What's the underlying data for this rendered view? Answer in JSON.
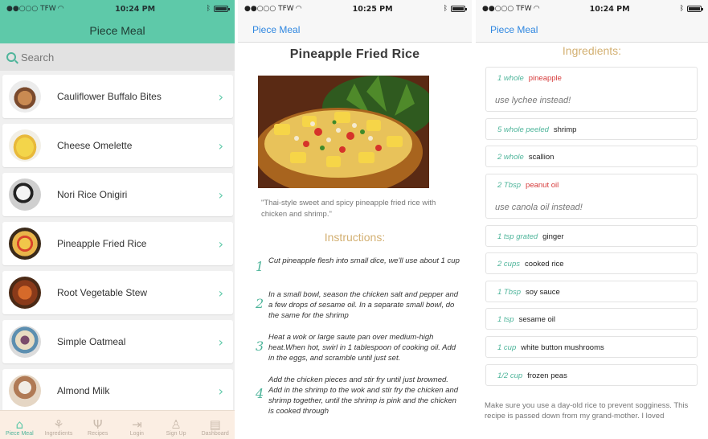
{
  "list_screen": {
    "status": {
      "carrier": "●●○○○ TFW",
      "time": "10:24 PM"
    },
    "title": "Piece Meal",
    "search_placeholder": "Search",
    "recipes": [
      {
        "name": "Cauliflower Buffalo Bites"
      },
      {
        "name": "Cheese Omelette"
      },
      {
        "name": "Nori Rice Onigiri"
      },
      {
        "name": "Pineapple Fried Rice"
      },
      {
        "name": "Root Vegetable Stew"
      },
      {
        "name": "Simple Oatmeal"
      },
      {
        "name": "Almond Milk"
      }
    ],
    "tabs": [
      {
        "label": "Piece Meal"
      },
      {
        "label": "Ingredients"
      },
      {
        "label": "Recipes"
      },
      {
        "label": "Login"
      },
      {
        "label": "Sign Up"
      },
      {
        "label": "Dashboard"
      }
    ],
    "chevron": "›"
  },
  "detail_screen": {
    "status": {
      "carrier": "●●○○○ TFW",
      "time": "10:25 PM"
    },
    "back_label": "Piece Meal",
    "title": "Pineapple Fried Rice",
    "description": "\"Thai-style sweet and spicy pineapple fried rice with chicken and shrimp.\"",
    "instructions_heading": "Instructions:",
    "steps": [
      {
        "num": "1",
        "text": "Cut pineapple flesh into small dice, we'll use about 1 cup"
      },
      {
        "num": "2",
        "text": "In a small bowl, season the chicken salt and pepper and a few drops of sesame oil. In a separate small bowl, do the same for the shrimp"
      },
      {
        "num": "3",
        "text": "Heat a wok or large saute pan over medium-high heat.When hot, swirl in 1 tablespoon of cooking oil. Add in the eggs, and scramble until just set."
      },
      {
        "num": "4",
        "text": "Add the chicken pieces and stir fry until just browned. Add in the shrimp to the wok and stir fry the chicken and shrimp together, until the shrimp is pink and the chicken is cooked through"
      }
    ]
  },
  "ingredients_screen": {
    "status": {
      "carrier": "●●○○○ TFW",
      "time": "10:24 PM"
    },
    "back_label": "Piece Meal",
    "heading": "Ingredients:",
    "items": [
      {
        "qty": "1 whole",
        "name": "pineapple",
        "highlight": true,
        "note": "use lychee instead!"
      },
      {
        "qty": "5 whole peeled",
        "name": "shrimp",
        "highlight": false
      },
      {
        "qty": "2 whole",
        "name": "scallion",
        "highlight": false
      },
      {
        "qty": "2 Tbsp",
        "name": "peanut oil",
        "highlight": true,
        "note": "use canola oil instead!"
      },
      {
        "qty": "1 tsp grated",
        "name": "ginger",
        "highlight": false
      },
      {
        "qty": "2 cups",
        "name": "cooked rice",
        "highlight": false
      },
      {
        "qty": "1 Tbsp",
        "name": "soy sauce",
        "highlight": false
      },
      {
        "qty": "1 tsp",
        "name": "sesame oil",
        "highlight": false
      },
      {
        "qty": "1 cup",
        "name": "white button mushrooms",
        "highlight": false
      },
      {
        "qty": "1/2 cup",
        "name": "frozen peas",
        "highlight": false
      }
    ],
    "tip": "Make sure you use a day-old rice to prevent sogginess. This recipe is passed down from my grand-mother. I loved"
  },
  "colors": {
    "accent": "#5ec9a9",
    "gold": "#d3b072",
    "link": "#2e86e0",
    "highlight_red": "#d63b3b"
  }
}
